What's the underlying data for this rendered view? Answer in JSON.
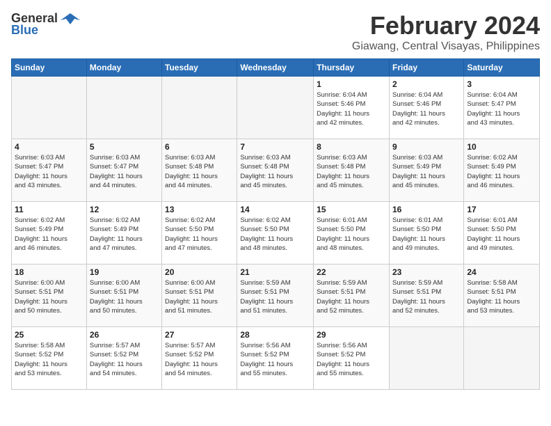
{
  "logo": {
    "general": "General",
    "blue": "Blue"
  },
  "title": "February 2024",
  "subtitle": "Giawang, Central Visayas, Philippines",
  "weekdays": [
    "Sunday",
    "Monday",
    "Tuesday",
    "Wednesday",
    "Thursday",
    "Friday",
    "Saturday"
  ],
  "weeks": [
    [
      {
        "day": "",
        "info": ""
      },
      {
        "day": "",
        "info": ""
      },
      {
        "day": "",
        "info": ""
      },
      {
        "day": "",
        "info": ""
      },
      {
        "day": "1",
        "info": "Sunrise: 6:04 AM\nSunset: 5:46 PM\nDaylight: 11 hours\nand 42 minutes."
      },
      {
        "day": "2",
        "info": "Sunrise: 6:04 AM\nSunset: 5:46 PM\nDaylight: 11 hours\nand 42 minutes."
      },
      {
        "day": "3",
        "info": "Sunrise: 6:04 AM\nSunset: 5:47 PM\nDaylight: 11 hours\nand 43 minutes."
      }
    ],
    [
      {
        "day": "4",
        "info": "Sunrise: 6:03 AM\nSunset: 5:47 PM\nDaylight: 11 hours\nand 43 minutes."
      },
      {
        "day": "5",
        "info": "Sunrise: 6:03 AM\nSunset: 5:47 PM\nDaylight: 11 hours\nand 44 minutes."
      },
      {
        "day": "6",
        "info": "Sunrise: 6:03 AM\nSunset: 5:48 PM\nDaylight: 11 hours\nand 44 minutes."
      },
      {
        "day": "7",
        "info": "Sunrise: 6:03 AM\nSunset: 5:48 PM\nDaylight: 11 hours\nand 45 minutes."
      },
      {
        "day": "8",
        "info": "Sunrise: 6:03 AM\nSunset: 5:48 PM\nDaylight: 11 hours\nand 45 minutes."
      },
      {
        "day": "9",
        "info": "Sunrise: 6:03 AM\nSunset: 5:49 PM\nDaylight: 11 hours\nand 45 minutes."
      },
      {
        "day": "10",
        "info": "Sunrise: 6:02 AM\nSunset: 5:49 PM\nDaylight: 11 hours\nand 46 minutes."
      }
    ],
    [
      {
        "day": "11",
        "info": "Sunrise: 6:02 AM\nSunset: 5:49 PM\nDaylight: 11 hours\nand 46 minutes."
      },
      {
        "day": "12",
        "info": "Sunrise: 6:02 AM\nSunset: 5:49 PM\nDaylight: 11 hours\nand 47 minutes."
      },
      {
        "day": "13",
        "info": "Sunrise: 6:02 AM\nSunset: 5:50 PM\nDaylight: 11 hours\nand 47 minutes."
      },
      {
        "day": "14",
        "info": "Sunrise: 6:02 AM\nSunset: 5:50 PM\nDaylight: 11 hours\nand 48 minutes."
      },
      {
        "day": "15",
        "info": "Sunrise: 6:01 AM\nSunset: 5:50 PM\nDaylight: 11 hours\nand 48 minutes."
      },
      {
        "day": "16",
        "info": "Sunrise: 6:01 AM\nSunset: 5:50 PM\nDaylight: 11 hours\nand 49 minutes."
      },
      {
        "day": "17",
        "info": "Sunrise: 6:01 AM\nSunset: 5:50 PM\nDaylight: 11 hours\nand 49 minutes."
      }
    ],
    [
      {
        "day": "18",
        "info": "Sunrise: 6:00 AM\nSunset: 5:51 PM\nDaylight: 11 hours\nand 50 minutes."
      },
      {
        "day": "19",
        "info": "Sunrise: 6:00 AM\nSunset: 5:51 PM\nDaylight: 11 hours\nand 50 minutes."
      },
      {
        "day": "20",
        "info": "Sunrise: 6:00 AM\nSunset: 5:51 PM\nDaylight: 11 hours\nand 51 minutes."
      },
      {
        "day": "21",
        "info": "Sunrise: 5:59 AM\nSunset: 5:51 PM\nDaylight: 11 hours\nand 51 minutes."
      },
      {
        "day": "22",
        "info": "Sunrise: 5:59 AM\nSunset: 5:51 PM\nDaylight: 11 hours\nand 52 minutes."
      },
      {
        "day": "23",
        "info": "Sunrise: 5:59 AM\nSunset: 5:51 PM\nDaylight: 11 hours\nand 52 minutes."
      },
      {
        "day": "24",
        "info": "Sunrise: 5:58 AM\nSunset: 5:51 PM\nDaylight: 11 hours\nand 53 minutes."
      }
    ],
    [
      {
        "day": "25",
        "info": "Sunrise: 5:58 AM\nSunset: 5:52 PM\nDaylight: 11 hours\nand 53 minutes."
      },
      {
        "day": "26",
        "info": "Sunrise: 5:57 AM\nSunset: 5:52 PM\nDaylight: 11 hours\nand 54 minutes."
      },
      {
        "day": "27",
        "info": "Sunrise: 5:57 AM\nSunset: 5:52 PM\nDaylight: 11 hours\nand 54 minutes."
      },
      {
        "day": "28",
        "info": "Sunrise: 5:56 AM\nSunset: 5:52 PM\nDaylight: 11 hours\nand 55 minutes."
      },
      {
        "day": "29",
        "info": "Sunrise: 5:56 AM\nSunset: 5:52 PM\nDaylight: 11 hours\nand 55 minutes."
      },
      {
        "day": "",
        "info": ""
      },
      {
        "day": "",
        "info": ""
      }
    ]
  ]
}
